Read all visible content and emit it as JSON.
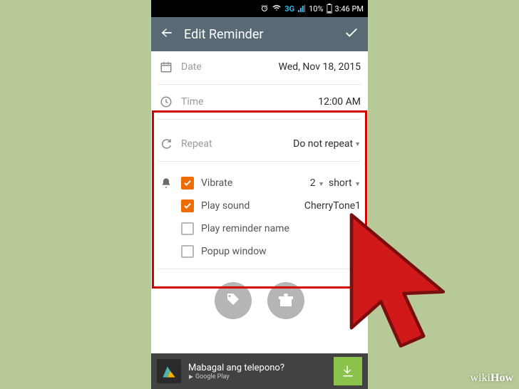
{
  "statusbar": {
    "network": "3G",
    "battery_pct": "10%",
    "time": "3:46 PM"
  },
  "appbar": {
    "title": "Edit Reminder"
  },
  "fields": {
    "date": {
      "label": "Date",
      "value": "Wed, Nov 18, 2015"
    },
    "time": {
      "label": "Time",
      "value": "12:00 AM"
    },
    "repeat": {
      "label": "Repeat",
      "value": "Do not repeat"
    }
  },
  "options": {
    "vibrate": {
      "label": "Vibrate",
      "checked": true,
      "count": "2",
      "duration": "short"
    },
    "playsound": {
      "label": "Play sound",
      "checked": true,
      "tone": "CherryTone1"
    },
    "playname": {
      "label": "Play reminder name",
      "checked": false
    },
    "popup": {
      "label": "Popup window",
      "checked": false
    }
  },
  "ad": {
    "headline": "Mabagal ang telepono?",
    "source": "Google Play"
  },
  "watermark": {
    "brand1": "wiki",
    "brand2": "How"
  }
}
